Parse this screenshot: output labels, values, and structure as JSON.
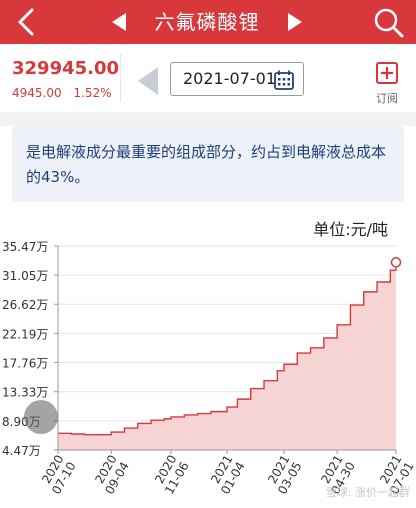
{
  "header": {
    "title": "六氟磷酸锂",
    "bg_color": "#d8383c"
  },
  "price": {
    "current": "329945.00",
    "change": "4945.00",
    "change_pct": "1.52%",
    "color": "#d8383c"
  },
  "date_picker": {
    "date": "2021-07-01"
  },
  "subscribe": {
    "label": "订阅"
  },
  "description": {
    "text": "是电解液成分最重要的组成部分，约占到电解液总成本的43%。"
  },
  "unit_label": "单位:元/吨",
  "watermark": "雪球: 涨价一起群",
  "chart_data": {
    "type": "area",
    "color": "#d8383c",
    "fill": "#f7d4d4",
    "yticks": [
      "35.47万",
      "31.05万",
      "26.62万",
      "22.19万",
      "17.76万",
      "13.33万",
      "8.90万",
      "4.47万"
    ],
    "ytick_values": [
      354700,
      310500,
      266200,
      221900,
      177600,
      133300,
      89000,
      44700
    ],
    "xticks": [
      "2020-07-10",
      "2020-09-04",
      "2020-11-06",
      "2021-01-04",
      "2021-03-05",
      "2021-04-30",
      "2021-07-01"
    ],
    "ylim": [
      44700,
      354700
    ],
    "x": [
      "2020-07-10",
      "2020-07-24",
      "2020-08-07",
      "2020-08-21",
      "2020-09-04",
      "2020-09-18",
      "2020-10-02",
      "2020-10-16",
      "2020-10-30",
      "2020-11-06",
      "2020-11-20",
      "2020-12-04",
      "2020-12-18",
      "2021-01-04",
      "2021-01-15",
      "2021-01-29",
      "2021-02-12",
      "2021-02-26",
      "2021-03-05",
      "2021-03-19",
      "2021-04-02",
      "2021-04-16",
      "2021-04-30",
      "2021-05-14",
      "2021-05-28",
      "2021-06-11",
      "2021-06-25",
      "2021-07-01"
    ],
    "values": [
      70000,
      69000,
      68000,
      68000,
      72000,
      78000,
      85000,
      90000,
      92000,
      95000,
      98000,
      100000,
      103000,
      110000,
      122000,
      138000,
      150000,
      165000,
      175000,
      192000,
      200000,
      215000,
      235000,
      265000,
      285000,
      300000,
      318000,
      329945
    ]
  }
}
